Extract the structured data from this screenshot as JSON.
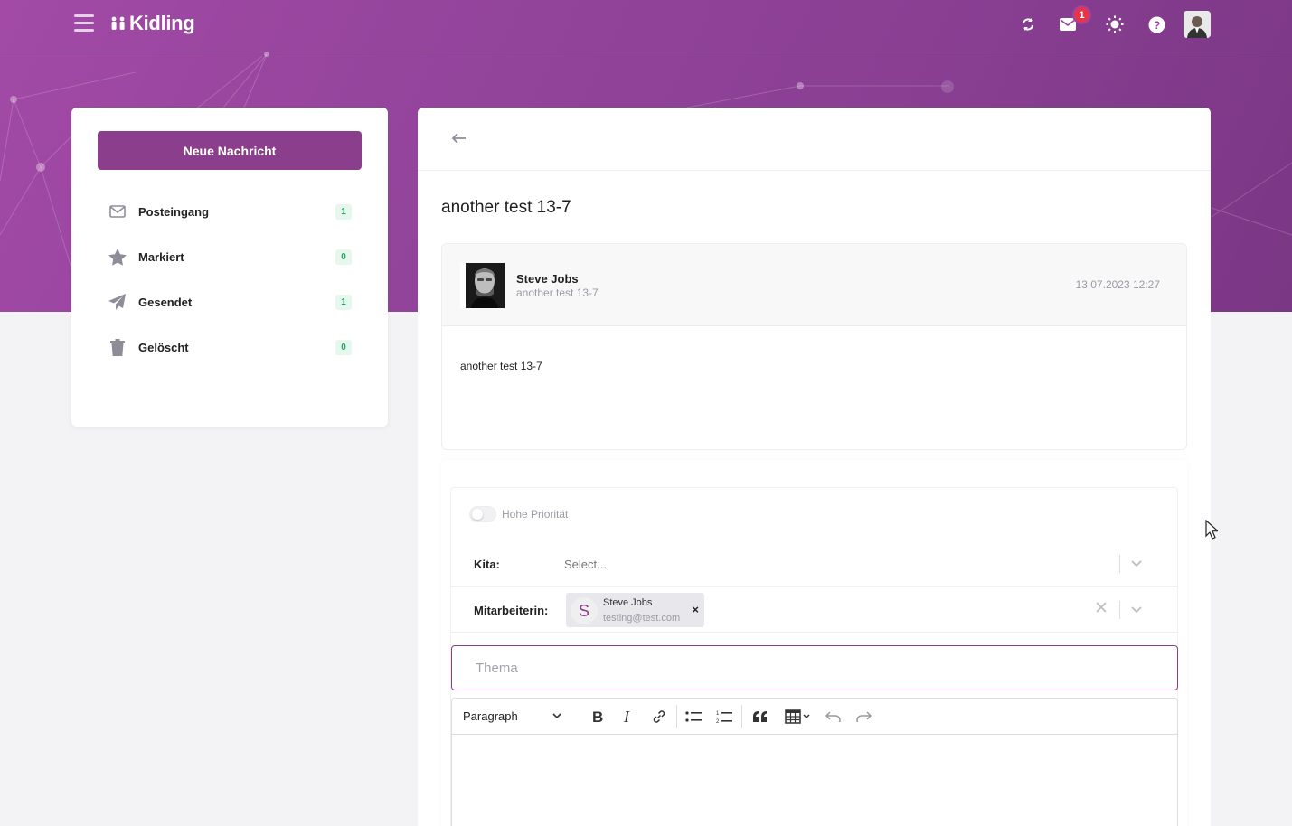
{
  "app": {
    "name": "Kidling",
    "notification_count": "1"
  },
  "colors": {
    "brand": "#8b3e8c",
    "header_bg": "#93449b",
    "badge": "#e8334b",
    "count_bg": "#e6f7ee",
    "count_text": "#27a662"
  },
  "topbar": {
    "icons": [
      "menu-icon",
      "refresh-icon",
      "mail-icon",
      "sun-icon",
      "help-icon",
      "avatar"
    ]
  },
  "sidebar": {
    "new_message_label": "Neue Nachricht",
    "items": [
      {
        "label": "Posteingang",
        "count": "1",
        "icon": "inbox-icon"
      },
      {
        "label": "Markiert",
        "count": "0",
        "icon": "star-icon"
      },
      {
        "label": "Gesendet",
        "count": "1",
        "icon": "send-icon"
      },
      {
        "label": "Gelöscht",
        "count": "0",
        "icon": "trash-icon"
      }
    ]
  },
  "message": {
    "subject": "another test 13-7",
    "sender": "Steve Jobs",
    "preview": "another test 13-7",
    "date": "13.07.2023 12:27",
    "body": "another test 13-7"
  },
  "reply": {
    "priority_label": "Hohe Priorität",
    "kita_label": "Kita:",
    "kita_placeholder": "Select...",
    "staff_label": "Mitarbeiterin:",
    "recipient": {
      "initial": "S",
      "name": "Steve Jobs",
      "email": "testing@test.com"
    },
    "subject_placeholder": "Thema",
    "toolbar": {
      "paragraph": "Paragraph"
    }
  }
}
